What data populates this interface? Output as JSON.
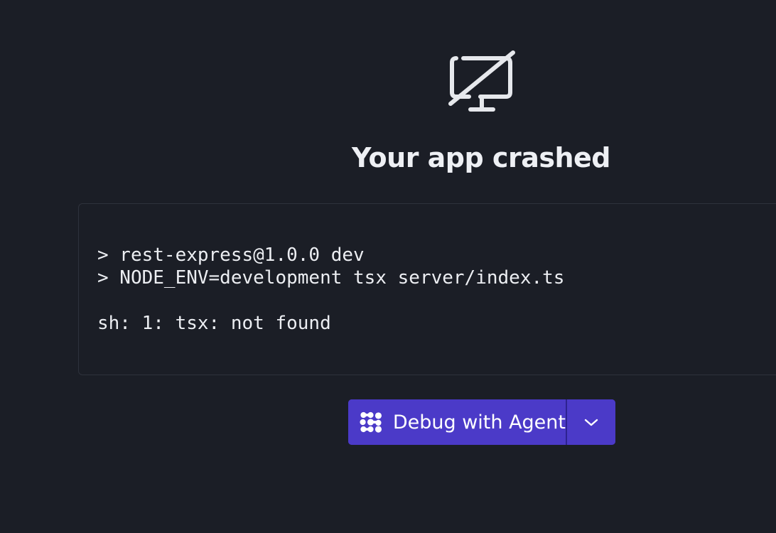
{
  "crash_screen": {
    "icon": "monitor-off-icon",
    "title": "Your app crashed"
  },
  "log": {
    "lines": [
      "> rest-express@1.0.0 dev",
      "> NODE_ENV=development tsx server/index.ts",
      "",
      "sh: 1: tsx: not found"
    ]
  },
  "debug_action": {
    "label": "Debug with Agent",
    "icon": "agent-icon",
    "menu_icon": "chevron-down-icon"
  },
  "colors": {
    "background": "#1b1e26",
    "panel_border": "#2e323c",
    "button": "#4b3ac8",
    "button_divider": "#2d2290",
    "text": "#eceef2"
  }
}
